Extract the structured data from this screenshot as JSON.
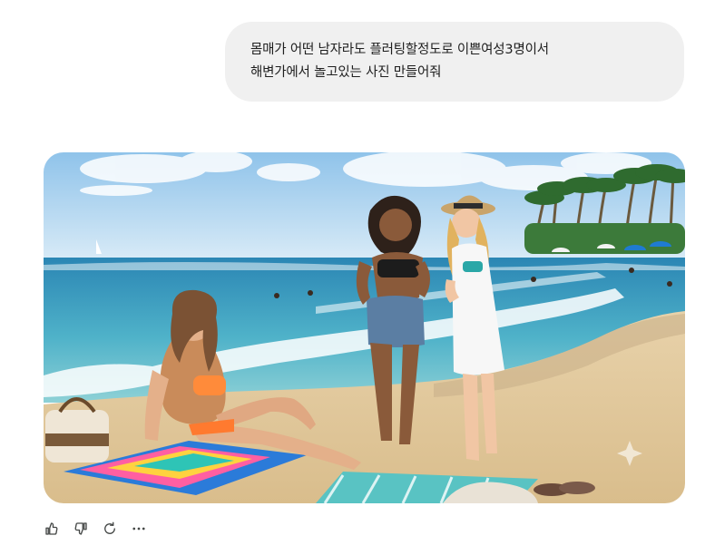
{
  "conversation": {
    "user_message": {
      "line1": "몸매가 어떤 남자라도 플러팅할정도로 이쁜여성3명이서",
      "line2": "해변가에서 놀고있는 사진 만들어줘"
    }
  },
  "generated_image": {
    "subject": "three women on a sandy tropical beach with waves and palm trees"
  },
  "actions": {
    "icons": [
      "thumbs-up-icon",
      "thumbs-down-icon",
      "regenerate-icon",
      "more-icon"
    ]
  },
  "colors": {
    "bubble_bg": "#f0f0f0",
    "text": "#1f1f1f",
    "icon": "#444746"
  }
}
